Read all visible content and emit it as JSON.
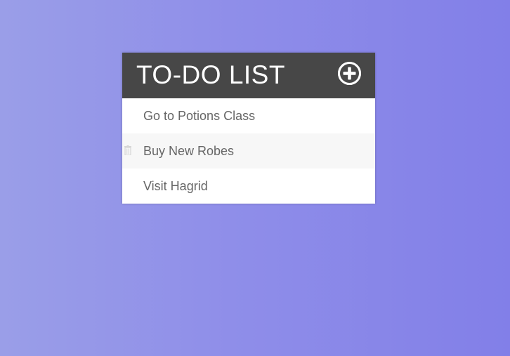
{
  "header": {
    "title": "TO-DO LIST",
    "add_icon": "plus-circle-icon"
  },
  "todos": [
    {
      "text": "Go to Potions Class",
      "hovered": false
    },
    {
      "text": "Buy New Robes",
      "hovered": true,
      "delete_icon": "trash-icon"
    },
    {
      "text": "Visit Hagrid",
      "hovered": false
    }
  ],
  "colors": {
    "header_bg": "#474747",
    "item_text": "#666666",
    "item_hover_bg": "#f7f7f7",
    "background_left": "#9a9ee8",
    "background_right": "#827fe8"
  }
}
